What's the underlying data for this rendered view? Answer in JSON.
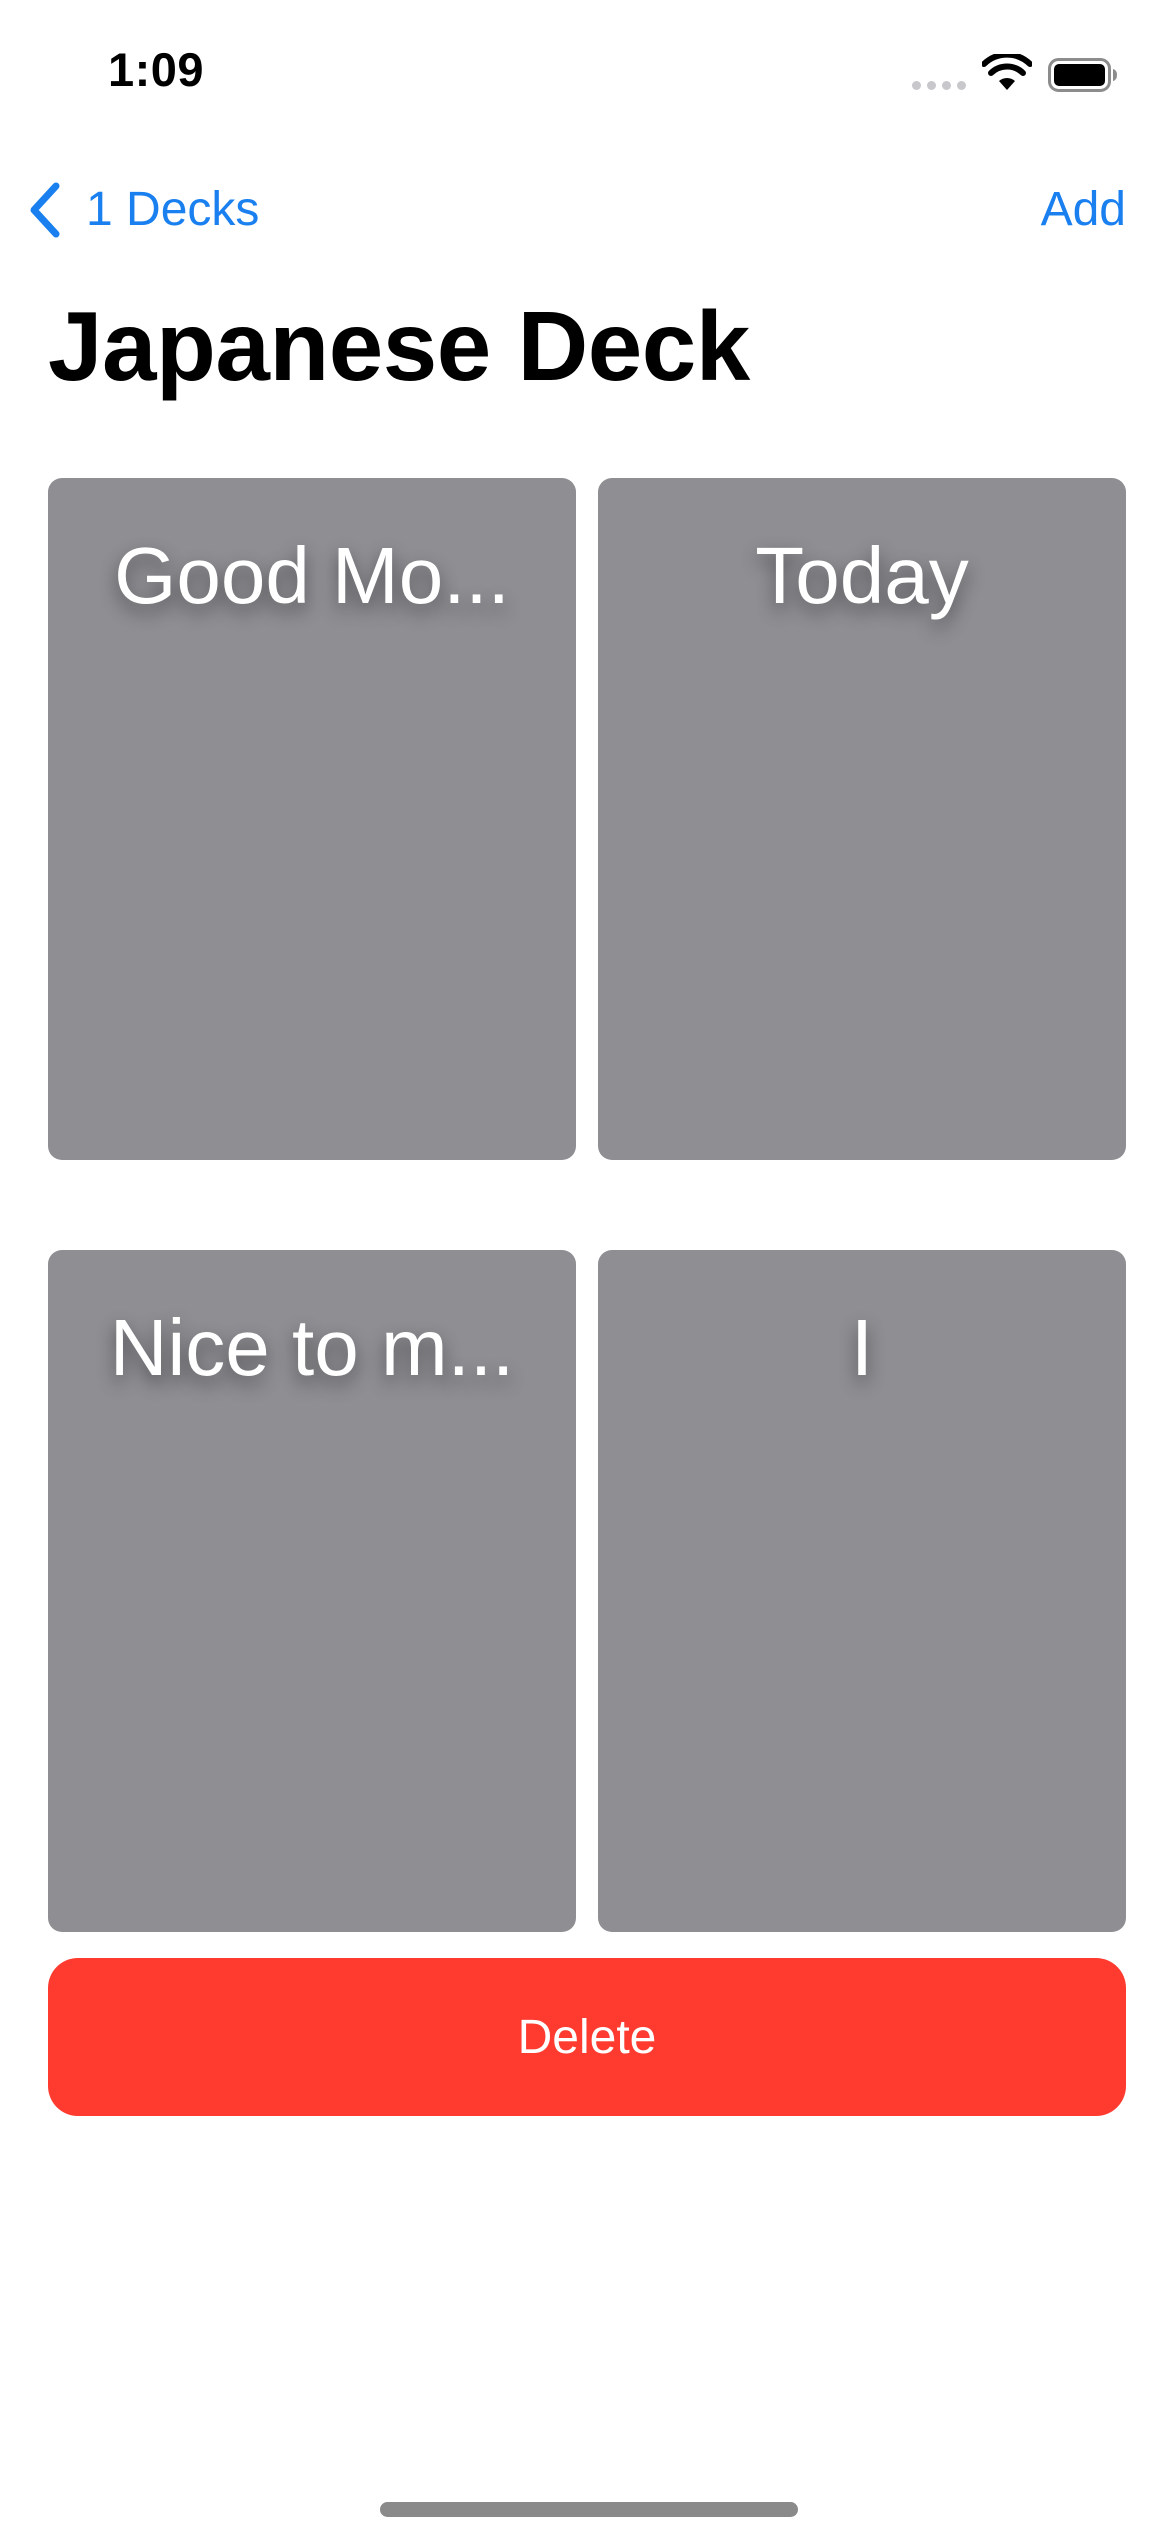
{
  "status_bar": {
    "time": "1:09",
    "icons": [
      "signal-icon",
      "wifi-icon",
      "battery-icon"
    ]
  },
  "nav": {
    "back_label": "1 Decks",
    "back_icon": "chevron-left-icon",
    "add_label": "Add"
  },
  "title": "Japanese Deck",
  "cards": [
    {
      "label": "Good Mo..."
    },
    {
      "label": "Today"
    },
    {
      "label": "Nice to m..."
    },
    {
      "label": "I"
    }
  ],
  "delete_label": "Delete",
  "colors": {
    "accent": "#1a80f0",
    "card_background": "#8e8e93",
    "destructive": "#ff3b30"
  }
}
